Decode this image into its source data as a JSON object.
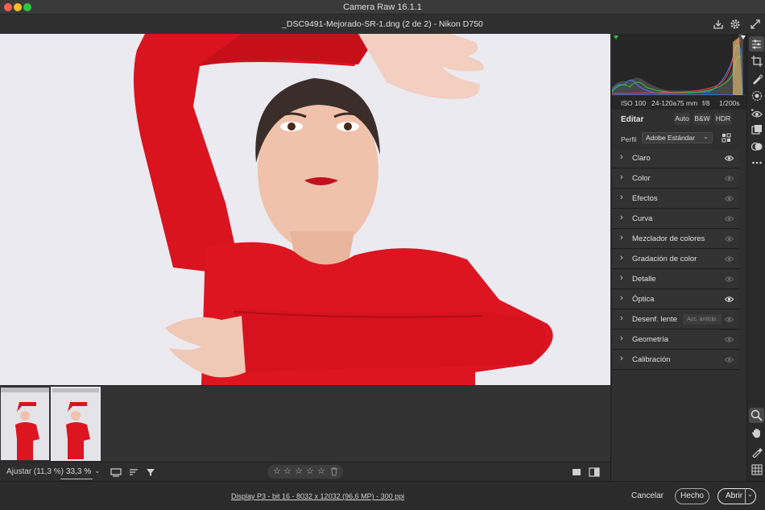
{
  "window": {
    "title": "Camera Raw 16.1.1"
  },
  "file": {
    "title": "_DSC9491-Mejorado-SR-1.dng (2 de 2) -  Nikon D750"
  },
  "header_icons": [
    "save-icon",
    "gear-icon"
  ],
  "exif": {
    "iso": "ISO 100",
    "lens": "24-120a75 mm",
    "aperture": "f/8",
    "shutter": "1/200s"
  },
  "edit": {
    "title": "Editar",
    "modes": [
      "Auto",
      "B&W",
      "HDR"
    ],
    "profile_label": "Perfil",
    "profile_value": "Adobe Estándar"
  },
  "sections": [
    {
      "label": "Claro",
      "visible_on": true
    },
    {
      "label": "Color",
      "visible_on": false
    },
    {
      "label": "Efectos",
      "visible_on": false
    },
    {
      "label": "Curva",
      "visible_on": false
    },
    {
      "label": "Mezclador de colores",
      "visible_on": false
    },
    {
      "label": "Gradación de color",
      "visible_on": false
    },
    {
      "label": "Detalle",
      "visible_on": false
    },
    {
      "label": "Óptica",
      "visible_on": true
    },
    {
      "label": "Desenf. lente",
      "visible_on": false,
      "badge": "Acc. anticip."
    },
    {
      "label": "Geometría",
      "visible_on": false
    },
    {
      "label": "Calibración",
      "visible_on": false
    }
  ],
  "zoom": {
    "fit_label": "Ajustar (11,3 %)",
    "value": "33,3 %"
  },
  "rating": {
    "stars": 0,
    "max": 5
  },
  "status": {
    "workflow": "Display P3 - bit 16 - 8032 x 12032 (96,6 MP) - 300 ppi"
  },
  "buttons": {
    "cancel": "Cancelar",
    "done": "Hecho",
    "open": "Abrir"
  },
  "filmstrip": {
    "count": 2,
    "selected_index": 1
  },
  "tools": [
    "edit-sliders-icon",
    "crop-icon",
    "healing-icon",
    "masking-icon",
    "red-eye-icon",
    "presets-icon",
    "snapshots-icon",
    "more-icon",
    "zoom-icon",
    "hand-icon",
    "color-sampler-icon",
    "grid-icon"
  ],
  "colors": {
    "accent_red": "#e0101e",
    "panel_bg": "#2f2f2f",
    "canvas_bg": "#e9e8ee"
  }
}
